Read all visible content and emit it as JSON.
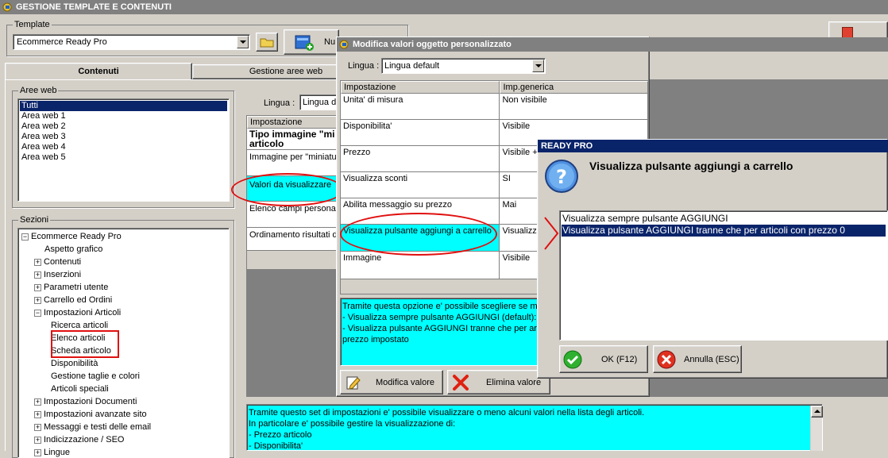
{
  "main_window": {
    "title": "GESTIONE TEMPLATE E CONTENUTI",
    "template_label": "Template",
    "template_value": "Ecommerce Ready Pro",
    "new_button_label": "Nu",
    "tabs": [
      "Contenuti",
      "Gestione aree web"
    ],
    "aree_web_label": "Aree web",
    "aree_web": [
      "Tutti",
      "Area web 1",
      "Area web 2",
      "Area web 3",
      "Area web 4",
      "Area web 5"
    ],
    "sezioni_label": "Sezioni",
    "tree": [
      {
        "label": "Ecommerce Ready Pro",
        "level": 0,
        "exp": "−"
      },
      {
        "label": "Aspetto grafico",
        "level": 1,
        "exp": ""
      },
      {
        "label": "Contenuti",
        "level": 1,
        "exp": "+"
      },
      {
        "label": "Inserzioni",
        "level": 1,
        "exp": "+"
      },
      {
        "label": "Parametri utente",
        "level": 1,
        "exp": "+"
      },
      {
        "label": "Carrello ed Ordini",
        "level": 1,
        "exp": "+"
      },
      {
        "label": "Impostazioni Articoli",
        "level": 1,
        "exp": "−"
      },
      {
        "label": "Ricerca articoli",
        "level": 2,
        "exp": ""
      },
      {
        "label": "Elenco articoli",
        "level": 2,
        "exp": ""
      },
      {
        "label": "Scheda articolo",
        "level": 2,
        "exp": ""
      },
      {
        "label": "Disponibilità",
        "level": 2,
        "exp": ""
      },
      {
        "label": "Gestione taglie e colori",
        "level": 2,
        "exp": ""
      },
      {
        "label": "Articoli speciali",
        "level": 2,
        "exp": ""
      },
      {
        "label": "Impostazioni Documenti",
        "level": 1,
        "exp": "+"
      },
      {
        "label": "Impostazioni avanzate sito",
        "level": 1,
        "exp": "+"
      },
      {
        "label": "Messaggi e testi delle email",
        "level": 1,
        "exp": "+"
      },
      {
        "label": "Indicizzazione / SEO",
        "level": 1,
        "exp": "+"
      },
      {
        "label": "Lingue",
        "level": 1,
        "exp": "+"
      }
    ],
    "lingua_label": "Lingua :",
    "lingua_value": "Lingua d",
    "grid_header": "Impostazione",
    "grid_rows": [
      "Tipo immagine \"mi articolo (obbligator",
      "Immagine per \"miniatu",
      "Valori da visualizzare",
      "Elenco campi persona",
      "Ordinamento risultati d"
    ],
    "description": [
      "Tramite questo set di impostazioni e' possibile visualizzare o meno alcuni valori nella lista degli articoli.",
      "In particolare e' possibile gestire la visualizzazione di:",
      "- Prezzo articolo",
      "- Disponibilita'"
    ]
  },
  "modal": {
    "title": "Modifica valori oggetto personalizzato",
    "lingua_label": "Lingua :",
    "lingua_value": "Lingua default",
    "col1_header": "Impostazione",
    "col2_header": "Imp.generica",
    "rows": [
      {
        "setting": "Unita' di misura",
        "value": "Non visibile"
      },
      {
        "setting": "Disponibilita'",
        "value": "Visibile"
      },
      {
        "setting": "Prezzo",
        "value": "Visibile +"
      },
      {
        "setting": "Visualizza sconti",
        "value": "SI"
      },
      {
        "setting": "Abilita messaggio su prezzo",
        "value": "Mai"
      },
      {
        "setting": "Visualizza pulsante aggiungi a carrello",
        "value": "Visualizz che per a"
      },
      {
        "setting": "Immagine",
        "value": "Visibile"
      }
    ],
    "help_lines": [
      "Tramite questa opzione e' possibile scegliere se mo",
      "- Visualizza sempre pulsante AGGIUNGI (default): i",
      "- Visualizza pulsante AGGIUNGI tranne che per arti",
      "prezzo impostato"
    ],
    "modify_button": "Modifica valore",
    "delete_button": "Elimina valore"
  },
  "dialog": {
    "title": "READY PRO",
    "question": "Visualizza pulsante aggiungi a carrello",
    "options": [
      "Visualizza sempre pulsante AGGIUNGI",
      "Visualizza pulsante AGGIUNGI tranne che per articoli con prezzo 0"
    ],
    "selected_index": 1,
    "ok_button": "OK (F12)",
    "cancel_button": "Annulla (ESC)"
  },
  "colors": {
    "highlight": "#0a246a",
    "cyan": "#00ffff",
    "annotation_red": "#e01010"
  }
}
